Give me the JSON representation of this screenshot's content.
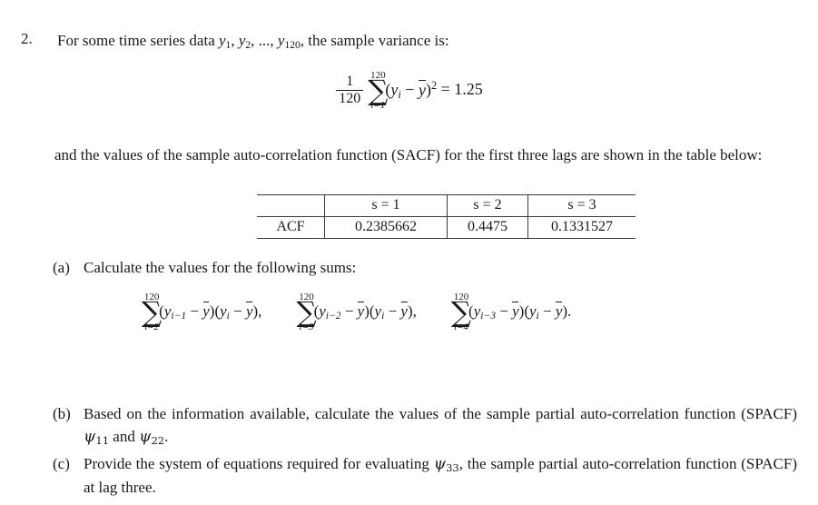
{
  "document": {
    "question_number": "2.",
    "intro": {
      "text_before_vars": "For some time series data ",
      "variables": "y₁, y₂, …, y₁₂₀",
      "text_after_vars": ", the sample variance is:",
      "full": "For some time series data y1, y2, ..., y120, the sample variance is:"
    },
    "variance_formula": {
      "fraction_numerator": "1",
      "fraction_denominator": "120",
      "sum_upper_limit": "120",
      "sum_lower_limit": "i=1",
      "summand": "(yi − ȳ)²",
      "equals": "=",
      "value": "1.25",
      "plain": "(1/120) Σ_{i=1}^{120} (y_i - ȳ)² = 1.25"
    },
    "sacf_paragraph": "and the values of the sample auto-correlation function (SACF) for the first three lags are shown in the table below:",
    "acf_table": {
      "row_label": "ACF",
      "corner_label": "",
      "column_headers": [
        "s = 1",
        "s = 2",
        "s = 3"
      ],
      "values": [
        "0.2385662",
        "0.4475",
        "0.1331527"
      ]
    },
    "parts": [
      {
        "letter": "(a)",
        "text": "Calculate the values for the following sums:",
        "sums": [
          {
            "upper_limit": "120",
            "lower_limit": "i=2",
            "body": "(yi−1 − ȳ)(yi − ȳ),",
            "lag": 1
          },
          {
            "upper_limit": "120",
            "lower_limit": "i=3",
            "body": "(yi−2 − ȳ)(yi − ȳ),",
            "lag": 2
          },
          {
            "upper_limit": "120",
            "lower_limit": "i=4",
            "body": "(yi−3 − ȳ)(yi − ȳ).",
            "lag": 3
          }
        ]
      },
      {
        "letter": "(b)",
        "text_part1": "Based on the information available, calculate the values of the sample partial auto-correlation function (SPACF) ",
        "psi_first": "ψ",
        "psi_first_sub": "11",
        "text_mid": " and ",
        "psi_second": "ψ",
        "psi_second_sub": "22",
        "text_end": ".",
        "full": "Based on the information available, calculate the values of the sample partial auto-correlation function (SPACF) ψ11 and ψ22."
      },
      {
        "letter": "(c)",
        "text_part1": "Provide the system of equations required for evaluating ",
        "psi_first": "ψ",
        "psi_first_sub": "33",
        "text_end": ", the sample partial auto-correlation function (SPACF) at lag three.",
        "full": "Provide the system of equations required for evaluating ψ33, the sample partial auto-correlation function (SPACF) at lag three."
      }
    ]
  },
  "style": {
    "background_color": "#ffffff",
    "text_color": "#1a1a1a",
    "rule_color": "#3a3a3a"
  }
}
